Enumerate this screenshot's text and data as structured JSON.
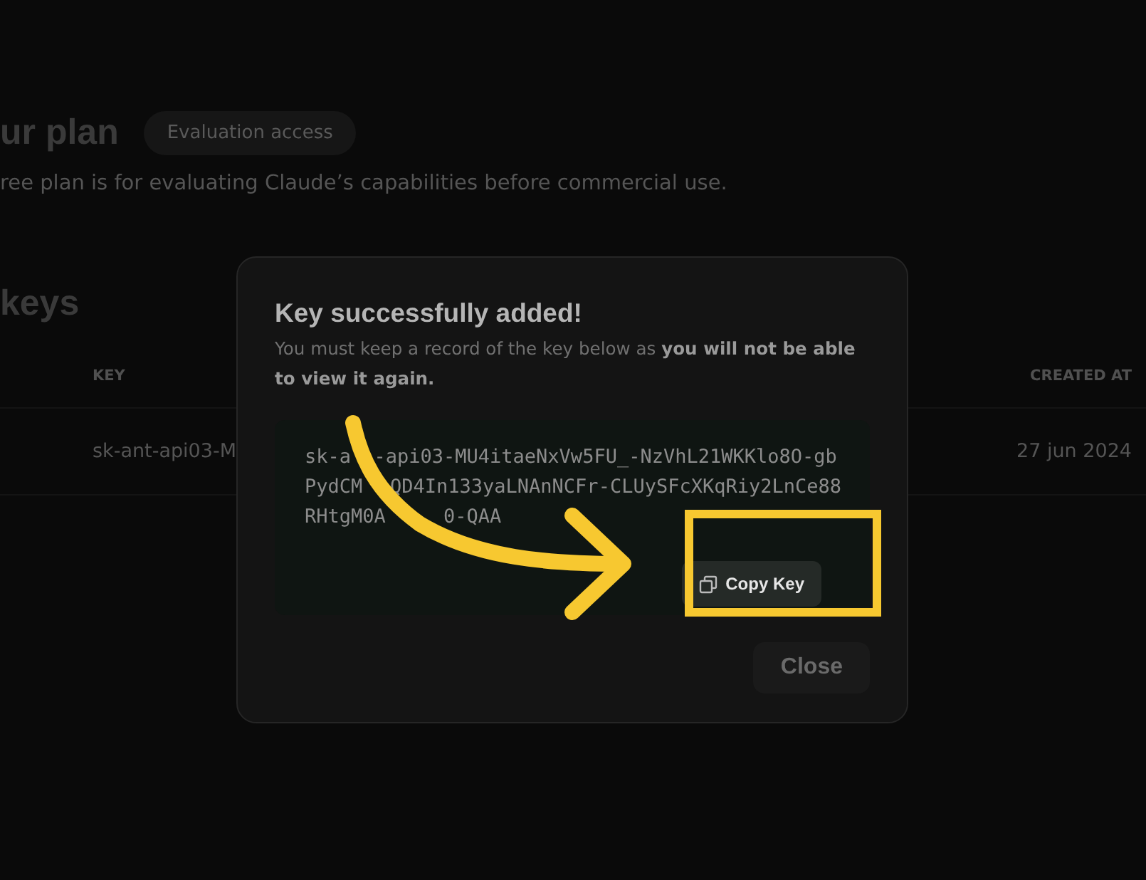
{
  "plan": {
    "title": "ur plan",
    "badge": "Evaluation access",
    "description": "ree plan is for evaluating Claude’s capabilities before commercial use."
  },
  "keys": {
    "title": "keys",
    "columns": [
      "KEY",
      "CREATED AT"
    ],
    "rows": [
      {
        "key": "sk-ant-api03-M",
        "created_at": "27 jun 2024"
      }
    ]
  },
  "dialog": {
    "title": "Key successfully added!",
    "message": "You must keep a record of the key below as **you will not be able to view it again.**",
    "key_lines": [
      [
        "sk-a",
        "-api03-MU4itaeNxVw5FU_-NzVhL21WKKlo8O-gb"
      ],
      [
        "PydCM",
        "QD4In133yaLNAnNCFr-CLUySFcXKqRiy2LnCe88"
      ],
      [
        "RHtgM0A",
        "0-QAA"
      ]
    ],
    "copy_button": "Copy Key",
    "close_button": "Close"
  },
  "annotation": {
    "arrow": true,
    "highlight": true
  }
}
